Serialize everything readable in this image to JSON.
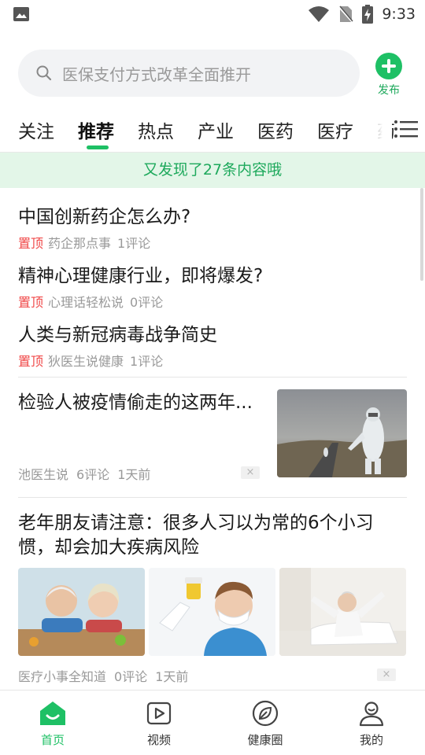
{
  "status_bar": {
    "time": "9:33"
  },
  "search": {
    "placeholder": "医保支付方式改革全面推开"
  },
  "publish": {
    "label": "发布"
  },
  "tabs": [
    "关注",
    "推荐",
    "热点",
    "产业",
    "医药",
    "医疗",
    "药"
  ],
  "active_tab": "推荐",
  "notice": "又发现了27条内容哦",
  "pinned": [
    {
      "title": "中国创新药企怎么办?",
      "tag": "置顶",
      "source": "药企那点事",
      "comments": "1评论"
    },
    {
      "title": "精神心理健康行业，即将爆发?",
      "tag": "置顶",
      "source": "心理话轻松说",
      "comments": "0评论"
    },
    {
      "title": "人类与新冠病毒战争简史",
      "tag": "置顶",
      "source": "狄医生说健康",
      "comments": "1评论"
    }
  ],
  "articles": [
    {
      "title": "检验人被疫情偷走的这两年...",
      "source": "池医生说",
      "comments": "6评论",
      "time": "1天前"
    },
    {
      "title": "老年朋友请注意：很多人习以为常的6个小习惯，却会加大疾病风险",
      "source": "医疗小事全知道",
      "comments": "0评论",
      "time": "1天前"
    }
  ],
  "dismiss": "×",
  "bottom_nav": [
    {
      "label": "首页",
      "icon": "home-icon"
    },
    {
      "label": "视频",
      "icon": "video-icon"
    },
    {
      "label": "健康圈",
      "icon": "leaf-icon"
    },
    {
      "label": "我的",
      "icon": "profile-icon"
    }
  ],
  "colors": {
    "accent": "#1ec065",
    "pin_tag": "#f04848",
    "notice_bg": "#e3f6e8"
  }
}
